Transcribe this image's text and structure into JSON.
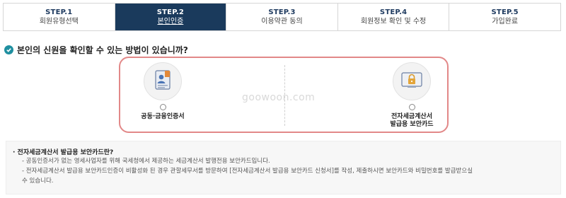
{
  "steps": [
    {
      "num": "STEP.1",
      "label": "회원유형선택",
      "active": false
    },
    {
      "num": "STEP.2",
      "label": "본인인증",
      "active": true
    },
    {
      "num": "STEP.3",
      "label": "이용약관 동의",
      "active": false
    },
    {
      "num": "STEP.4",
      "label": "회원정보 확인 및 수정",
      "active": false
    },
    {
      "num": "STEP.5",
      "label": "가입완료",
      "active": false
    }
  ],
  "question": "본인의 신원을 확인할 수 있는 방법이 있습니까?",
  "options": [
    {
      "label": "공동·금융인증서",
      "icon": "certificate-icon"
    },
    {
      "label_line1": "전자세금계산서",
      "label_line2": "발급용 보안카드",
      "icon": "security-card-icon"
    }
  ],
  "watermark": "goowoon.com",
  "info": {
    "title": "· 전자세금계산서 발급용 보안카드란?",
    "line1": "- 공동인증서가 없는 영세사업자를 위해 국세청에서 제공하는 세금계산서 발행전용 보안카드입니다.",
    "line2": "- 전자세금계산서 발급용 보안카드인증이 비활성화 된 경우 관할세무서를 방문하여 [전자세금계산서 발급용 보안카드 신청서]를 작성, 제출하시면 보안카드와 비밀번호를 발급받으실",
    "line3": "수 있습니다."
  },
  "colors": {
    "active_step": "#1a3a5c",
    "check": "#1f8fa0",
    "highlight_border": "#e28888"
  }
}
